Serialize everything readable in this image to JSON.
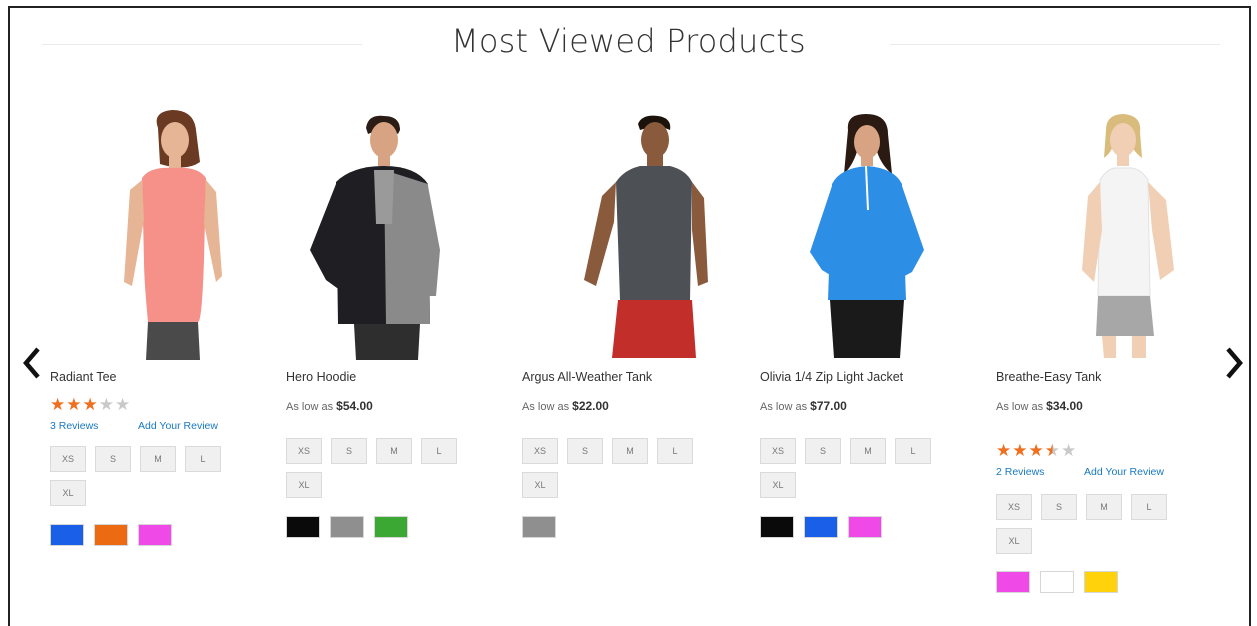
{
  "section": {
    "title": "Most Viewed Products"
  },
  "nav": {
    "prev_icon": "chevron-left-icon",
    "next_icon": "chevron-right-icon"
  },
  "products": [
    {
      "name": "Radiant Tee",
      "rating": 3,
      "reviews_label": "3  Reviews",
      "add_review_label": "Add Your Review",
      "sizes": [
        "XS",
        "S",
        "M",
        "L",
        "XL"
      ],
      "colors": [
        "#1a5fe8",
        "#ec6a12",
        "#ef4ae8"
      ]
    },
    {
      "name": "Hero Hoodie",
      "price_prefix": "As low as",
      "price": "$54.00",
      "sizes": [
        "XS",
        "S",
        "M",
        "L",
        "XL"
      ],
      "colors": [
        "#0a0a0a",
        "#8f8f8f",
        "#3aa832"
      ]
    },
    {
      "name": "Argus All-Weather Tank",
      "price_prefix": "As low as",
      "price": "$22.00",
      "sizes": [
        "XS",
        "S",
        "M",
        "L",
        "XL"
      ],
      "colors": [
        "#8f8f8f"
      ]
    },
    {
      "name": "Olivia 1/4 Zip Light Jacket",
      "price_prefix": "As low as",
      "price": "$77.00",
      "sizes": [
        "XS",
        "S",
        "M",
        "L",
        "XL"
      ],
      "colors": [
        "#0a0a0a",
        "#1a5fe8",
        "#ef4ae8"
      ]
    },
    {
      "name": "Breathe-Easy Tank",
      "price_prefix": "As low as",
      "price": "$34.00",
      "rating": 3.5,
      "reviews_label": "2  Reviews",
      "add_review_label": "Add Your Review",
      "sizes": [
        "XS",
        "S",
        "M",
        "L",
        "XL"
      ],
      "colors": [
        "#ef4ae8",
        "#ffffff",
        "#ffd20c"
      ]
    }
  ]
}
